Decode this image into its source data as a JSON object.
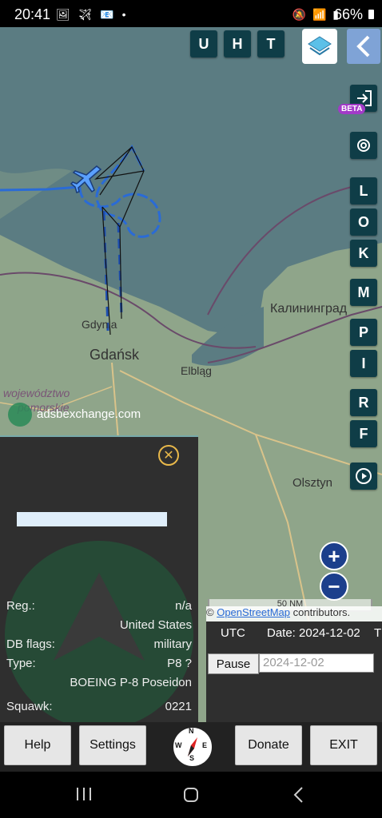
{
  "status": {
    "time": "20:41",
    "left_icons": "🖼 ✈ 📧 •",
    "right_icons": "🔕 📶 ▮",
    "battery": "66%"
  },
  "map": {
    "top_buttons": [
      "U",
      "H",
      "T"
    ],
    "side_buttons": [
      "L",
      "O",
      "K",
      "M",
      "P",
      "I",
      "R",
      "F"
    ],
    "beta_badge": "BETA",
    "watermark": "adsbexchange.com",
    "labels": {
      "kaliningrad": "Калининград",
      "gdynia": "Gdynia",
      "gdansk": "Gdańsk",
      "elblag": "Elbląg",
      "olsztyn": "Olsztyn",
      "wojewodztwo": "województwo",
      "pomorskie": "pomorskie"
    },
    "scale": "50 NM",
    "attribution_prefix": "©",
    "attribution_link": "OpenStreetMap",
    "attribution_suffix": "contributors.",
    "colors": {
      "water": "#5b7c82",
      "land": "#8fa58a",
      "track": "#2a6bd6",
      "button": "#0f3d47"
    }
  },
  "aircraft": {
    "reg_label": "Reg.:",
    "reg_value": "n/a",
    "country": "United States",
    "dbflags_label": "DB flags:",
    "dbflags_value": "military",
    "type_label": "Type:",
    "type_value": "P8 ?",
    "model": "BOEING P-8 Poseidon",
    "squawk_label": "Squawk:",
    "squawk_value": "0221"
  },
  "time_panel": {
    "utc": "UTC",
    "date_label": "Date: 2024-12-02",
    "extra": "T",
    "pause_label": "Pause",
    "date_value": "2024-12-02"
  },
  "bottom_bar": {
    "help": "Help",
    "settings": "Settings",
    "compass": {
      "n": "N",
      "e": "E",
      "s": "S",
      "w": "W"
    },
    "donate": "Donate",
    "exit": "EXIT"
  }
}
